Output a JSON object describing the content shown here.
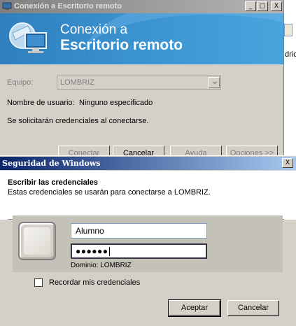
{
  "rdp_window": {
    "title": "Conexión a Escritorio remoto",
    "banner_line1": "Conexión a",
    "banner_line2": "Escritorio remoto",
    "computer_label": "Equipo:",
    "computer_value": "LOMBRIZ",
    "username_label": "Nombre de usuario:",
    "username_value": "Ninguno especificado",
    "credentials_note": "Se solicitarán credenciales al conectarse.",
    "buttons": {
      "connect": "Conectar",
      "cancel": "Cancelar",
      "help": "Ayuda",
      "options": "Opciones >>"
    },
    "caption_buttons": {
      "minimize": "_",
      "maximize": "□",
      "close": "X"
    }
  },
  "background_fragment": {
    "text": "dric"
  },
  "security_dialog": {
    "title": "Seguridad de Windows",
    "close_glyph": "X",
    "heading": "Escribir las credenciales",
    "subheading": "Estas credenciales se usarán para conectarse a LOMBRIZ.",
    "username_value": "Alumno",
    "password_value": "●●●●●●",
    "domain_text": "Dominio: LOMBRIZ",
    "remember_label": "Recordar mis credenciales",
    "remember_checked": false,
    "buttons": {
      "accept": "Aceptar",
      "cancel": "Cancelar"
    }
  },
  "colors": {
    "title_active_start": "#0a246a",
    "title_active_end": "#a6caf0",
    "banner_blue": "#2f7fbf",
    "dialog_face": "#d4d0c8"
  }
}
